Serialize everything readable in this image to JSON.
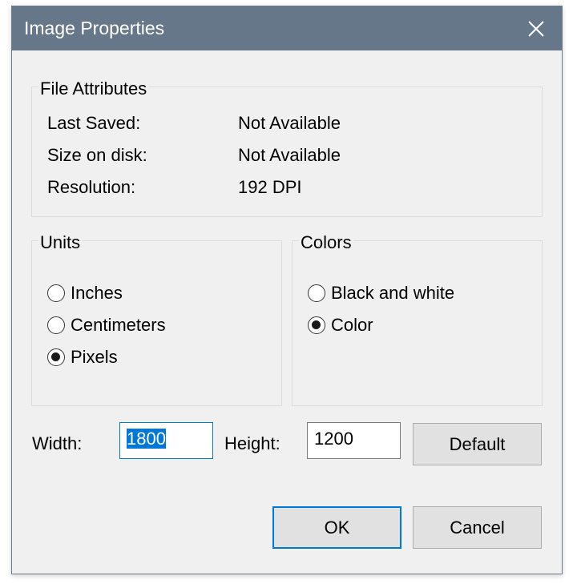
{
  "window": {
    "title": "Image Properties",
    "close_icon": "close-icon"
  },
  "file_attributes": {
    "legend": "File Attributes",
    "rows": [
      {
        "label": "Last Saved:",
        "value": "Not Available"
      },
      {
        "label": "Size on disk:",
        "value": "Not Available"
      },
      {
        "label": "Resolution:",
        "value": "192 DPI"
      }
    ]
  },
  "units": {
    "legend": "Units",
    "options": [
      {
        "label": "Inches",
        "checked": false
      },
      {
        "label": "Centimeters",
        "checked": false
      },
      {
        "label": "Pixels",
        "checked": true
      }
    ]
  },
  "colors": {
    "legend": "Colors",
    "options": [
      {
        "label": "Black and white",
        "checked": false
      },
      {
        "label": "Color",
        "checked": true
      }
    ]
  },
  "size": {
    "width_label": "Width:",
    "width_value": "1800",
    "height_label": "Height:",
    "height_value": "1200",
    "default_label": "Default"
  },
  "buttons": {
    "ok_label": "OK",
    "cancel_label": "Cancel"
  },
  "theme": {
    "titlebar_color": "#667789",
    "accent_color": "#0078d7",
    "dialog_background": "#f0f0f0"
  }
}
